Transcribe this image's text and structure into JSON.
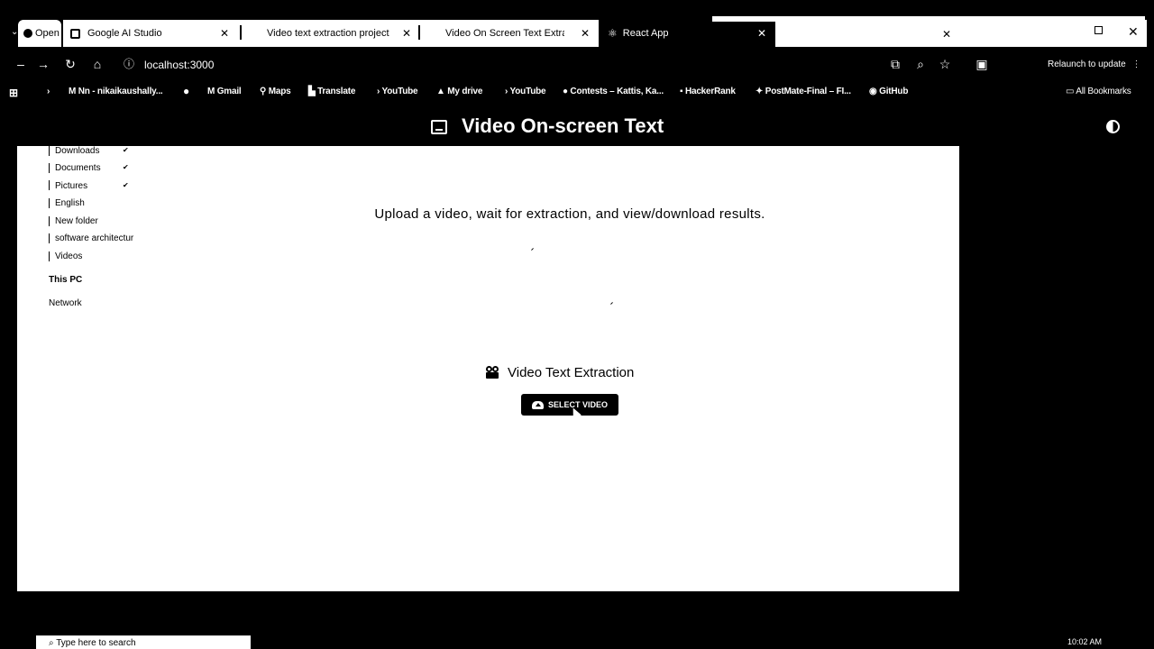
{
  "browser": {
    "tabs": [
      {
        "label": "Open",
        "active": false
      },
      {
        "label": "Google AI Studio",
        "active": false
      },
      {
        "label": "Video text extraction project",
        "active": false
      },
      {
        "label": "Video On Screen Text Extract",
        "active": false
      },
      {
        "label": "React App",
        "active": true
      }
    ],
    "address": "localhost:3000",
    "relaunch_label": "Relaunch to update",
    "bookmarks": [
      "Nn - nikaikaushally...",
      "Gmail",
      "Maps",
      "Translate",
      "YouTube",
      "My drive",
      "YouTube",
      "Contests – Kattis, Ka...",
      "HackerRank",
      "PostMate-Final – FI...",
      "GitHub"
    ],
    "all_bookmarks": "All Bookmarks"
  },
  "app": {
    "title": "Video On-screen Text",
    "subtitle": "Upload a video, wait for extraction, and view/download results.",
    "section_title": "Video Text Extraction",
    "select_button": "SELECT VIDEO"
  },
  "explorer": {
    "items": [
      {
        "label": "Downloads",
        "pinned": true
      },
      {
        "label": "Documents",
        "pinned": true
      },
      {
        "label": "Pictures",
        "pinned": true
      },
      {
        "label": "English",
        "pinned": false
      },
      {
        "label": "New folder",
        "pinned": false
      },
      {
        "label": "software architectur",
        "pinned": false
      },
      {
        "label": "Videos",
        "pinned": false
      }
    ],
    "this_pc": "This PC",
    "network": "Network"
  },
  "taskbar": {
    "search_placeholder": "Type here to search",
    "time": "10:02 AM"
  },
  "colors": {
    "page_bg": "#ffffff",
    "chrome_bg": "#000000",
    "button_bg": "#000000"
  }
}
